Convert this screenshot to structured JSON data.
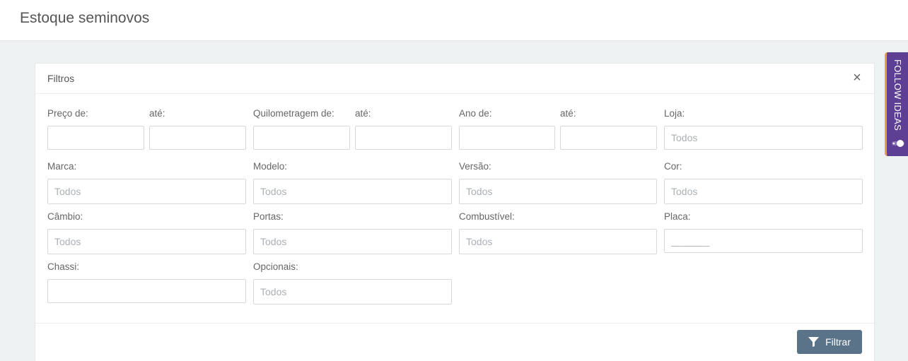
{
  "page": {
    "title": "Estoque seminovos"
  },
  "filters": {
    "title": "Filtros",
    "close_symbol": "×",
    "labels": {
      "preco_de": "Preço de:",
      "preco_ate": "até:",
      "km_de": "Quilometragem de:",
      "km_ate": "até:",
      "ano_de": "Ano de:",
      "ano_ate": "até:",
      "loja": "Loja:",
      "marca": "Marca:",
      "modelo": "Modelo:",
      "versao": "Versão:",
      "cor": "Cor:",
      "cambio": "Câmbio:",
      "portas": "Portas:",
      "combustivel": "Combustível:",
      "placa": "Placa:",
      "chassi": "Chassi:",
      "opcionais": "Opcionais:"
    },
    "placeholders": {
      "todos": "Todos",
      "placa_mask": "_______"
    },
    "filter_button": "Filtrar"
  },
  "follow_widget": {
    "label": "FOLLOW IDEAS",
    "icon": "toggle-icon"
  }
}
